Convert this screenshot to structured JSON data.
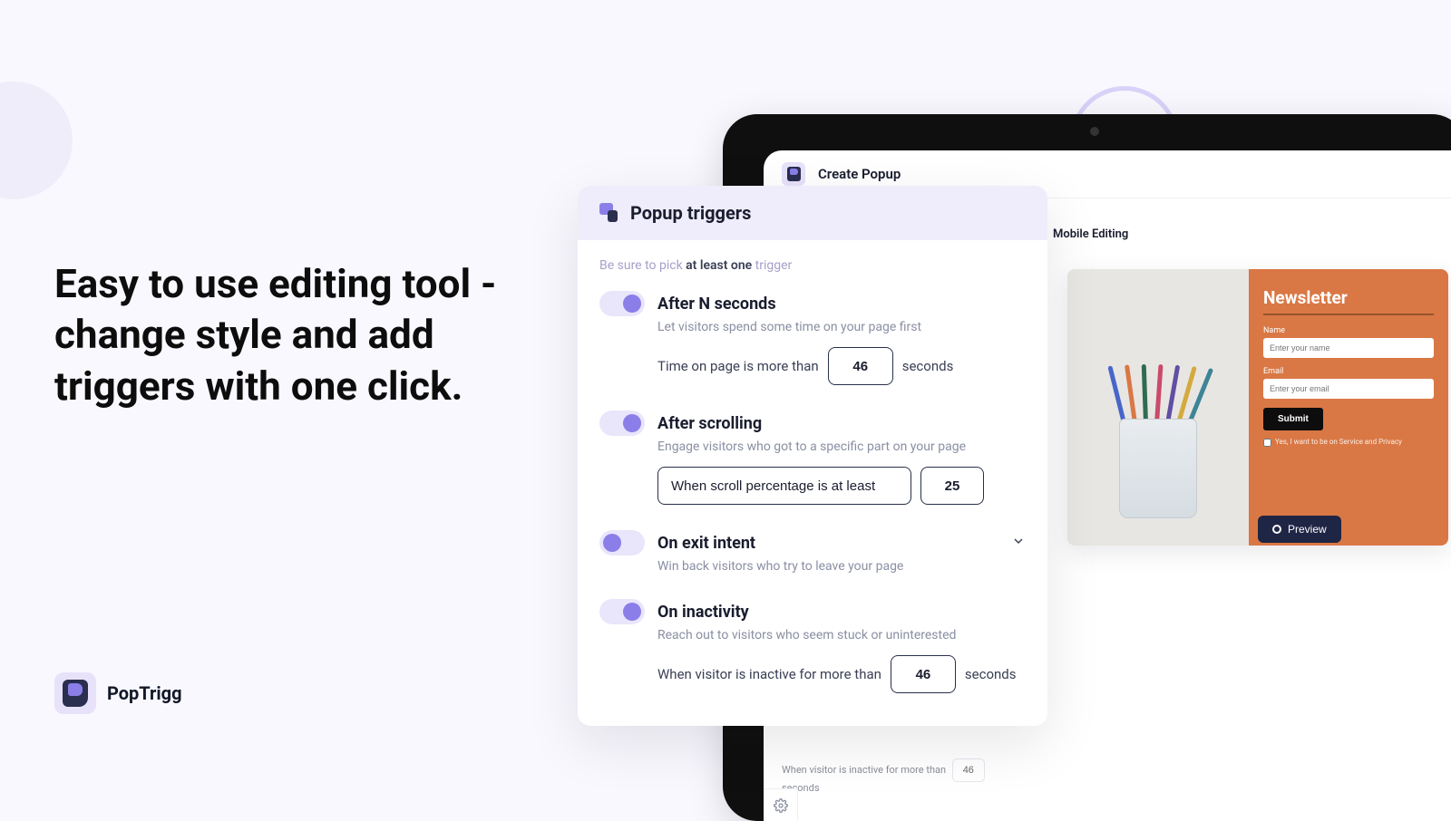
{
  "hero": {
    "heading": "Easy to use editing tool - change style and add triggers with one click."
  },
  "brand": {
    "name": "PopTrigg"
  },
  "topbar": {
    "title": "Create Popup"
  },
  "mobile_editing": {
    "label": "Mobile Editing"
  },
  "preview_button": {
    "label": "Preview"
  },
  "preview_form": {
    "heading": "Newsletter",
    "name_label": "Name",
    "name_placeholder": "Enter your name",
    "email_label": "Email",
    "email_placeholder": "Enter your email",
    "submit": "Submit",
    "consent": "Yes, I want to be on Service and Privacy"
  },
  "panel": {
    "title": "Popup triggers",
    "note_prefix": "Be sure to pick ",
    "note_bold": "at least one",
    "note_suffix": " trigger"
  },
  "triggers": {
    "after_seconds": {
      "title": "After N seconds",
      "desc": "Let visitors spend some time on your page first",
      "row_prefix": "Time on page is more than",
      "value": "46",
      "row_suffix": "seconds"
    },
    "after_scrolling": {
      "title": "After scrolling",
      "desc": "Engage visitors who got to a specific part on your page",
      "select_text": "When scroll percentage is at least",
      "value": "25"
    },
    "exit_intent": {
      "title": "On exit intent",
      "desc": "Win back visitors who try to leave your page"
    },
    "inactivity": {
      "title": "On inactivity",
      "desc": "Reach out to visitors who seem stuck or uninterested",
      "row_prefix": "When visitor is inactive for more than",
      "value": "46",
      "row_suffix": "seconds"
    }
  },
  "background_hint": "page",
  "bg_inactivity": {
    "text": "When visitor is inactive for more than",
    "value": "46",
    "suffix": "seconds"
  }
}
